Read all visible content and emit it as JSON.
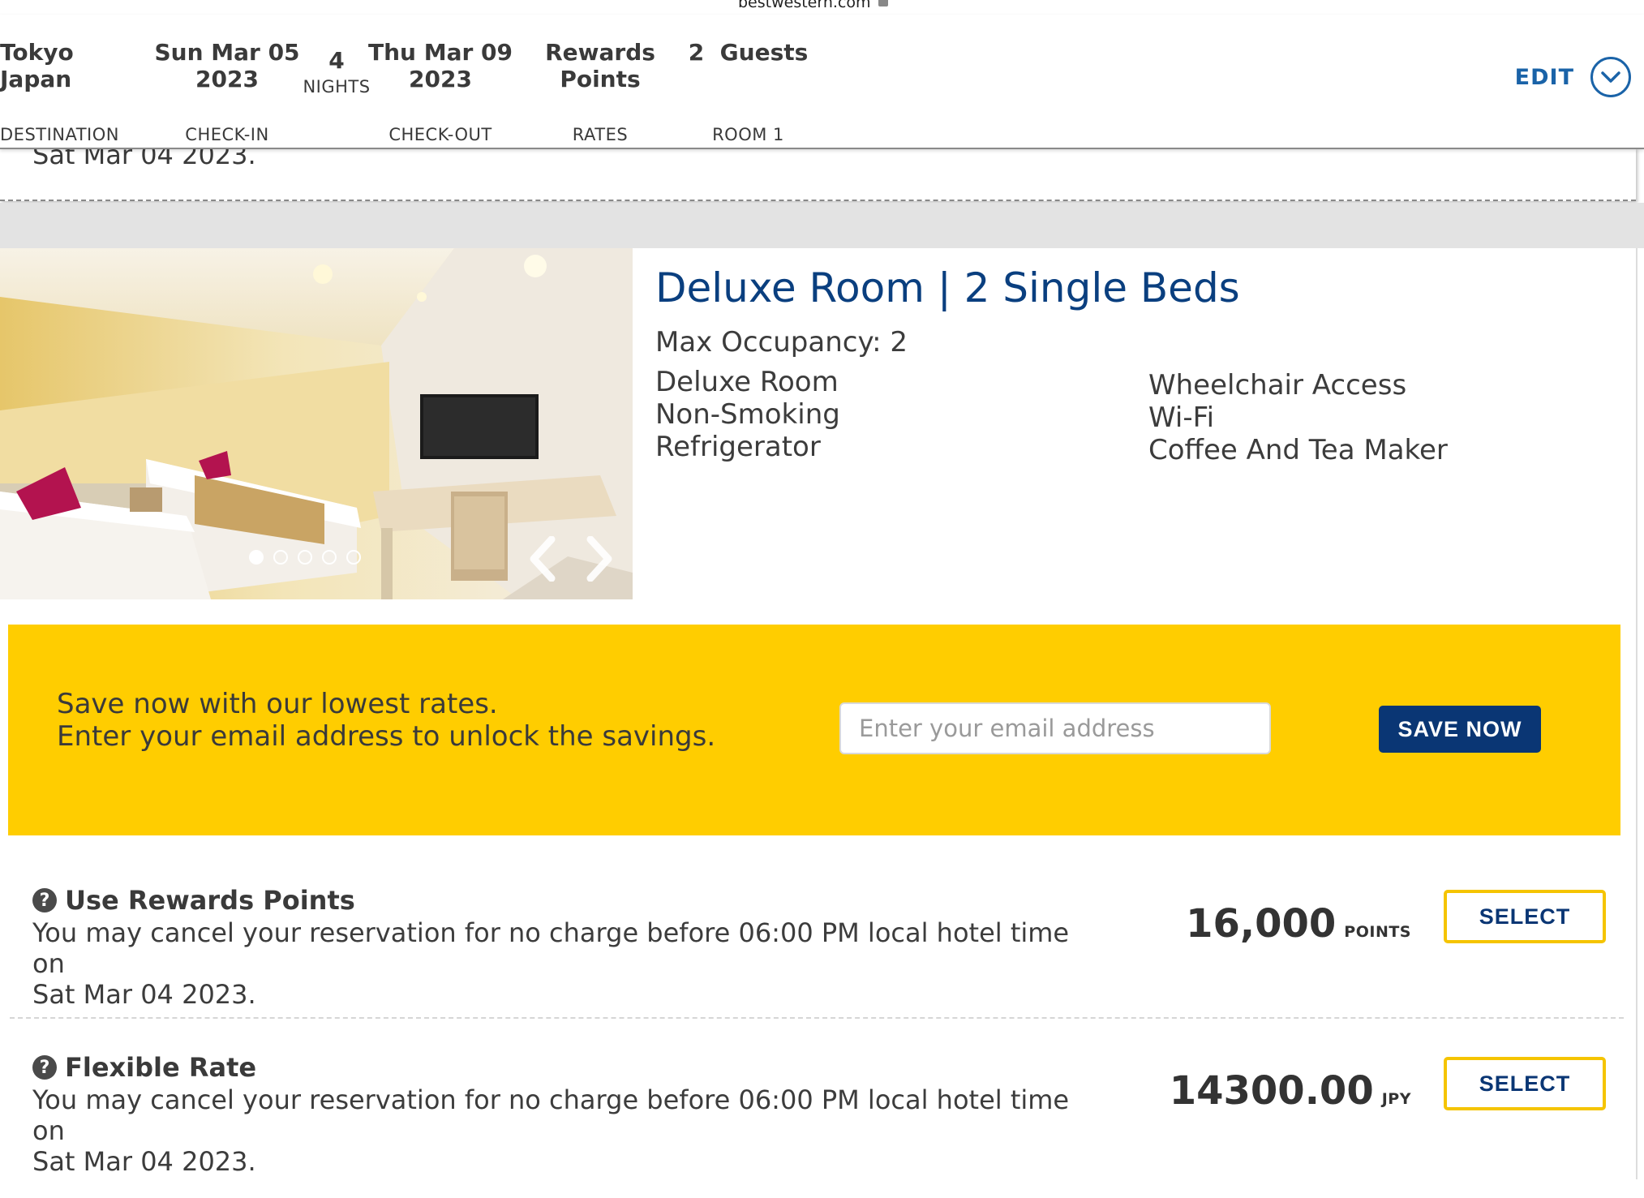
{
  "browser": {
    "domain": "bestwestern.com"
  },
  "summary": {
    "destination": {
      "line1": "Tokyo",
      "line2": "Japan",
      "label": "DESTINATION"
    },
    "checkin": {
      "line1": "Sun Mar 05",
      "line2": "2023",
      "label": "CHECK-IN"
    },
    "nights": {
      "count": "4",
      "label": "NIGHTS"
    },
    "checkout": {
      "line1": "Thu Mar 09",
      "line2": "2023",
      "label": "CHECK-OUT"
    },
    "rates": {
      "line1": "Rewards",
      "line2": "Points",
      "label": "RATES"
    },
    "room": {
      "line1": "2  Guests",
      "label": "ROOM 1"
    },
    "edit_label": "EDIT"
  },
  "previous_card": {
    "cut_text": "Sat Mar 04 2023."
  },
  "room": {
    "title": "Deluxe Room | 2 Single Beds",
    "max_occupancy": "Max Occupancy: 2",
    "amenities_left": [
      "Deluxe Room",
      "Non-Smoking",
      "Refrigerator"
    ],
    "amenities_right": [
      "Wheelchair Access",
      "Wi-Fi",
      "Coffee And Tea Maker"
    ],
    "carousel": {
      "total": 5,
      "active": 1
    }
  },
  "promo": {
    "line1": "Save now with our lowest rates.",
    "line2": "Enter your email address to unlock the savings.",
    "email_placeholder": "Enter your email address",
    "button_label": "SAVE NOW"
  },
  "rates": [
    {
      "title": "Use Rewards Points",
      "desc_line1": "You may cancel your reservation for no charge before 06:00 PM local hotel time on",
      "desc_line2": "Sat Mar 04 2023.",
      "price": "16,000",
      "unit": "POINTS",
      "button": "SELECT"
    },
    {
      "title": "Flexible Rate",
      "desc_line1": "You may cancel your reservation for no charge before 06:00 PM local hotel time on",
      "desc_line2": "Sat Mar 04 2023.",
      "price": "14300.00",
      "unit": "JPY",
      "button": "SELECT"
    }
  ],
  "colors": {
    "brand_blue": "#0a3674",
    "link_blue": "#1a63a8",
    "promo_yellow": "#ffcd00",
    "select_border": "#f5c400"
  }
}
